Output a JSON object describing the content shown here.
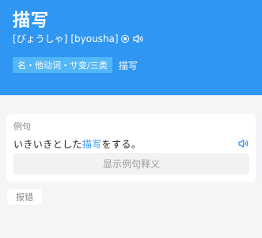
{
  "entry": {
    "word": "描写",
    "kana": "[びょうしゃ]",
    "romaji": "[byousha]",
    "icons": [
      "record-circle-icon",
      "speaker-icon"
    ],
    "pos_tag": "名・他动词・サ变/三类",
    "definition": "描写"
  },
  "example": {
    "section_label": "例句",
    "sentence_before": "いきいきとした",
    "sentence_highlight": "描写",
    "sentence_after": "をする。",
    "show_button": "显示例句释义"
  },
  "report_button": "报错",
  "colors": {
    "header_bg": "#2f96f2",
    "tag_bg": "#53b6f6",
    "accent": "#2f96f2",
    "page_bg": "#f4f5f7"
  }
}
